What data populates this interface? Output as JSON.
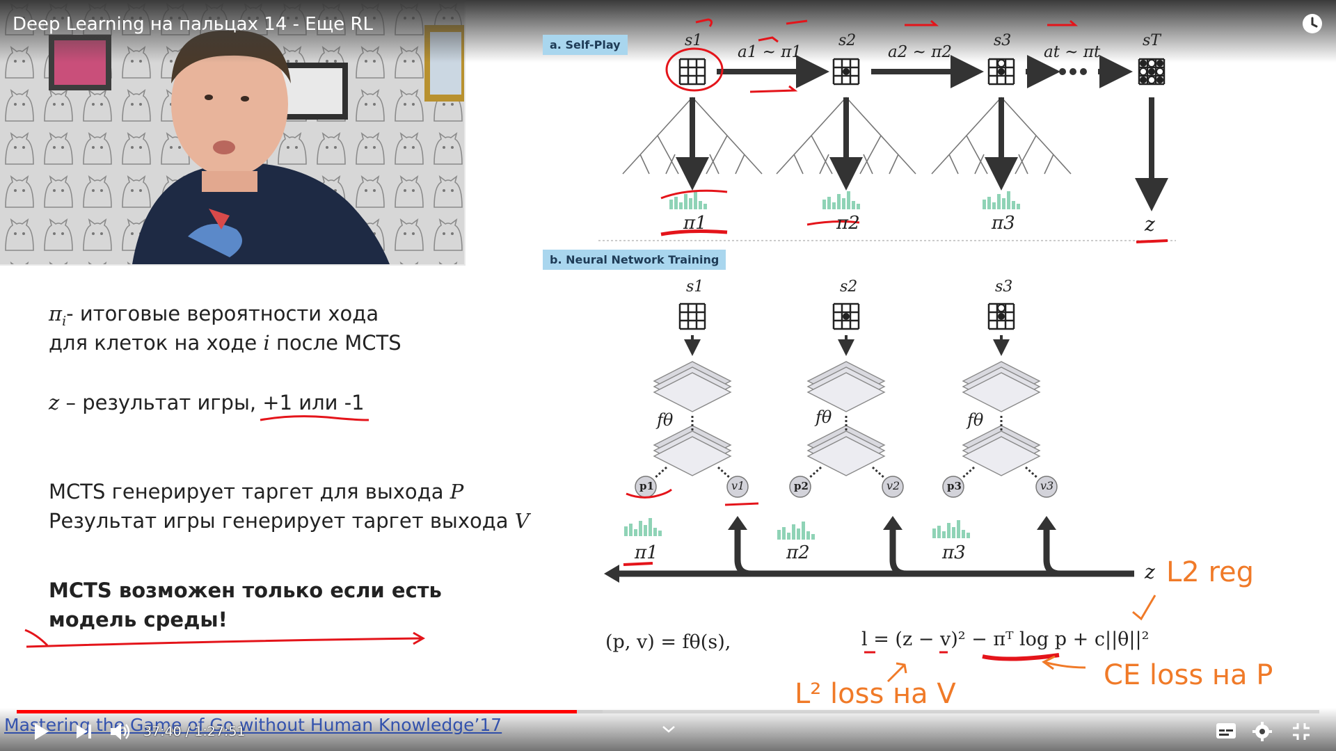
{
  "video": {
    "title": "Deep Learning на пальцах 14 - Еще RL",
    "time_current": "37:40",
    "time_separator": " / ",
    "time_total": "1:27:51",
    "progress_fraction": 0.43,
    "buffer_fraction": 0.45,
    "source_caption": "Mastering the Game of Go without Human Knowledge’17"
  },
  "slide": {
    "pi_symbol": "π",
    "pi_sub": "i",
    "line1_rest": "- итоговые вероятности хода",
    "line2_pre": "для клеток на ходе ",
    "line2_i": "i",
    "line2_post": " после MCTS",
    "z_symbol": "z",
    "z_rest": " – результат игры, +1 или -1",
    "mcts_p_pre": "MCTS генерирует таргет для выхода ",
    "mcts_p_sym": "P",
    "mcts_v_pre": "Результат игры генерирует таргет выхода ",
    "mcts_v_sym": "V",
    "bold_line1": "MCTS возможен только если есть",
    "bold_line2": "модель среды!"
  },
  "diagram": {
    "label_a": "a. Self-Play",
    "label_b": "b. Neural Network Training",
    "states_top": [
      "s1",
      "s2",
      "s3",
      "sT"
    ],
    "actions": [
      "a1 ~ π1",
      "a2 ~ π2",
      "at ~ πt"
    ],
    "policies_top": [
      "π1",
      "π2",
      "π3"
    ],
    "outcome": "z",
    "states_bottom": [
      "s1",
      "s2",
      "s3"
    ],
    "network": "fθ",
    "p_heads": [
      "p1",
      "p2",
      "p3"
    ],
    "v_heads": [
      "v1",
      "v2",
      "v3"
    ],
    "policies_bottom": [
      "π1",
      "π2",
      "π3"
    ],
    "eq_left": "(p, v) = fθ(s),",
    "eq_right": "l = (z − v)² − πᵀ log p + c||θ||²"
  },
  "annotations": {
    "l2_reg": "L2 reg",
    "l2_loss": "L² loss на V",
    "ce_loss": "CE loss на P"
  },
  "colors": {
    "progress": "#ff0000",
    "label_bg": "#a9d6ee",
    "ink_red": "#e4141a",
    "ink_orange": "#f07a28",
    "hist_green": "#8fd3b6"
  },
  "controls": [
    "play-icon",
    "next-icon",
    "volume-icon",
    "chevron-down-icon",
    "subtitles-icon",
    "gear-icon",
    "exit-fullscreen-icon",
    "watch-later-icon"
  ]
}
